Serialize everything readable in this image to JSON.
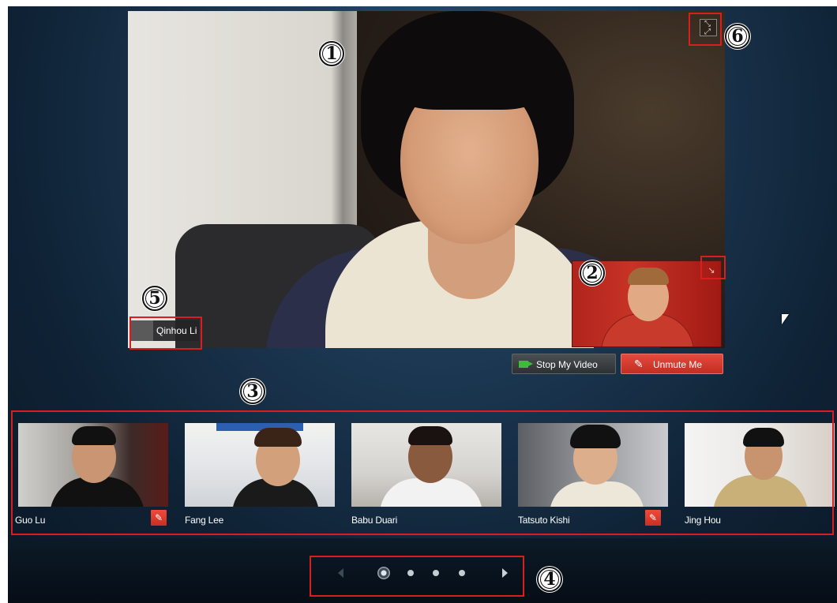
{
  "main_video": {
    "participant_name": "Qinhou Li",
    "expand_icon": "fullscreen-expand-icon",
    "self_view_toggle_icon": "collapse-arrow-icon"
  },
  "controls": {
    "stop_video_label": "Stop My Video",
    "stop_video_icon": "video-camera-icon",
    "unmute_label": "Unmute Me",
    "unmute_icon": "muted-microphone-icon",
    "camera_color": "#3fba3a",
    "unmute_color": "#d63a2d"
  },
  "participants": [
    {
      "name": "Guo Lu",
      "muted": true
    },
    {
      "name": "Fang Lee",
      "muted": false
    },
    {
      "name": "Babu Duari",
      "muted": false
    },
    {
      "name": "Tatsuto Kishi",
      "muted": true
    },
    {
      "name": "Jing Hou",
      "muted": false
    }
  ],
  "pager": {
    "page_count": 4,
    "current_page": 1,
    "prev_icon": "chevron-left-icon",
    "next_icon": "chevron-right-icon"
  },
  "callouts": [
    "1",
    "2",
    "3",
    "4",
    "5",
    "6"
  ],
  "annotation_color": "#d81e1e"
}
